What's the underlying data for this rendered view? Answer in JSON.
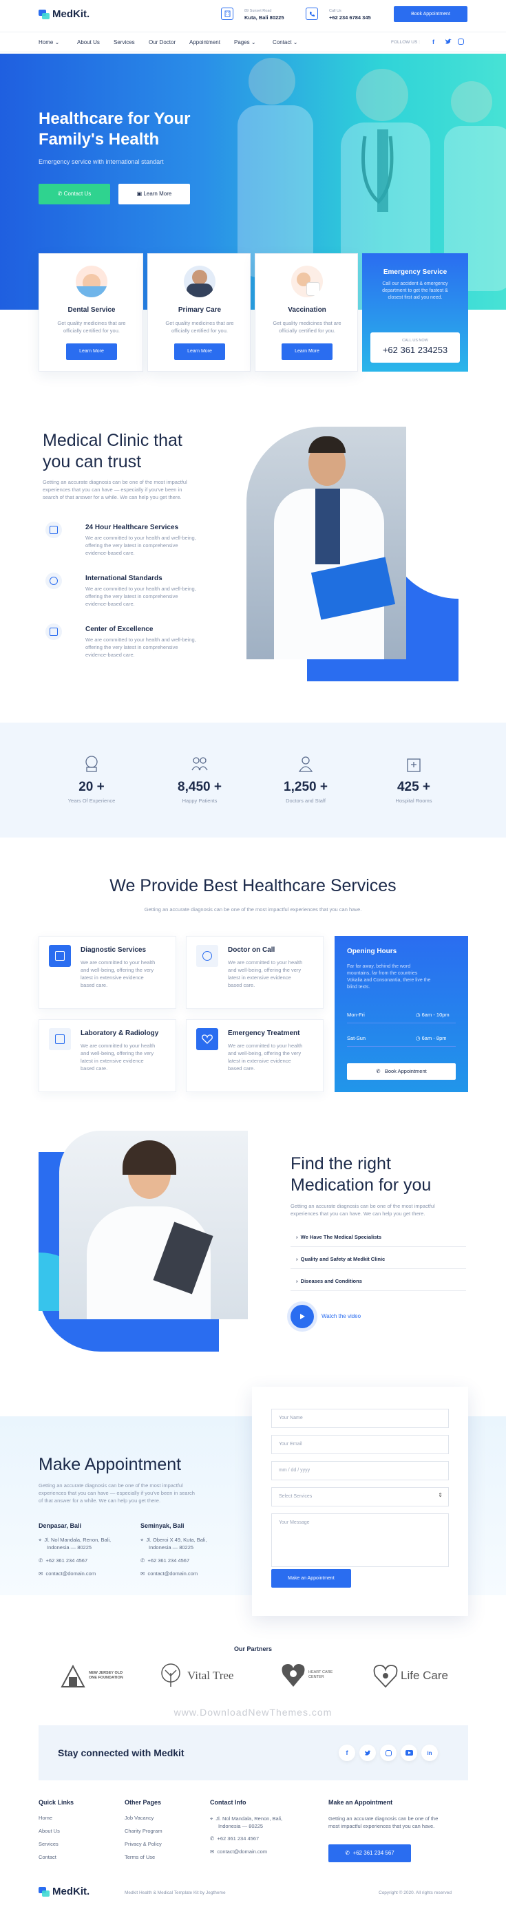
{
  "brand": {
    "name": "MedKit."
  },
  "topbar": {
    "address_small": "89 Sunset Road",
    "address": "Kuta, Bali 80225",
    "call_small": "Call Us",
    "call": "+62 234 6784 345",
    "book_label": "Book Appointment"
  },
  "nav": {
    "items": [
      "Home",
      "About Us",
      "Services",
      "Our Doctor",
      "Appointment",
      "Pages",
      "Contact"
    ],
    "follow": "FOLLOW US :"
  },
  "hero": {
    "title_line1": "Healthcare for Your",
    "title_line2": "Family's Health",
    "subtitle": "Emergency service with international standart",
    "contact_label": "Contact Us",
    "learn_label": "Learn More"
  },
  "services_top": [
    {
      "title": "Dental Service",
      "text1": "Get quality medicines that are",
      "text2": "officially certified for you.",
      "btn": "Learn More"
    },
    {
      "title": "Primary Care",
      "text1": "Get quality medicines that are",
      "text2": "officially certified for you.",
      "btn": "Learn More"
    },
    {
      "title": "Vaccination",
      "text1": "Get quality medicines that are",
      "text2": "officially certified for you.",
      "btn": "Learn More"
    }
  ],
  "emergency": {
    "title": "Emergency Service",
    "text1": "Call our accident & emergency",
    "text2": "department to get the fastest &",
    "text3": "closest first aid you need.",
    "call_small": "CALL US NOW",
    "phone": "+62 361 234253"
  },
  "clinic": {
    "title_line1": "Medical Clinic that",
    "title_line2": "you can trust",
    "intro1": "Getting an accurate diagnosis can be one of the most impactful",
    "intro2": "experiences that you can have — especially if you've been in",
    "intro3": "search of that answer for a while. We can help you get there.",
    "features": [
      {
        "title": "24 Hour Healthcare Services",
        "l1": "We are committed to your health and well-being,",
        "l2": "offering the very latest in comprehensive",
        "l3": "evidence-based care."
      },
      {
        "title": "International Standards",
        "l1": "We are committed to your health and well-being,",
        "l2": "offering the very latest in comprehensive",
        "l3": "evidence-based care."
      },
      {
        "title": "Center of Excellence",
        "l1": "We are committed to your health and well-being,",
        "l2": "offering the very latest in comprehensive",
        "l3": "evidence-based care."
      }
    ]
  },
  "stats": [
    {
      "num": "20 +",
      "label": "Years Of Experience"
    },
    {
      "num": "8,450 +",
      "label": "Happy Patients"
    },
    {
      "num": "1,250 +",
      "label": "Doctors and Staff"
    },
    {
      "num": "425 +",
      "label": "Hospital Rooms"
    }
  ],
  "provide": {
    "title": "We Provide Best Healthcare Services",
    "subtitle": "Getting an accurate diagnosis can be one of the most impactful experiences that you can have.",
    "cards": [
      {
        "title": "Diagnostic Services",
        "l1": "We are committed to your health",
        "l2": "and well-being, offering the very",
        "l3": "latest in extensive evidence",
        "l4": "based care."
      },
      {
        "title": "Doctor on Call",
        "l1": "We are committed to your health",
        "l2": "and well-being, offering the very",
        "l3": "latest in extensive evidence",
        "l4": "based care."
      },
      {
        "title": "Laboratory & Radiology",
        "l1": "We are committed to your health",
        "l2": "and well-being, offering the very",
        "l3": "latest in extensive evidence",
        "l4": "based care."
      },
      {
        "title": "Emergency Treatment",
        "l1": "We are committed to your health",
        "l2": "and well-being, offering the very",
        "l3": "latest in extensive evidence",
        "l4": "based care."
      }
    ],
    "hours": {
      "title": "Opening Hours",
      "l1": "Far far away, behind the word",
      "l2": "mountains, far from the countries",
      "l3": "Vokalia and Consonantia, there live the",
      "l4": "blind texts.",
      "d1": "Mon-Fri",
      "t1": "6am - 10pm",
      "d2": "Sat-Sun",
      "t2": "6am - 8pm",
      "btn": "Book Appointment"
    }
  },
  "medication": {
    "title_line1": "Find the right",
    "title_line2": "Medication for you",
    "intro1": "Getting an accurate diagnosis can be one of the most impactful",
    "intro2": "experiences that you can have. We can help you get there.",
    "items": [
      "We Have The Medical Specialists",
      "Quality and Safety at Medkit Clinic",
      "Diseases and Conditions"
    ],
    "video": "Watch the video"
  },
  "appointment": {
    "title": "Make Appointment",
    "intro1": "Getting an accurate diagnosis can be one of the most impactful",
    "intro2": "experiences that you can have — especially if you've been in search",
    "intro3": "of that answer for a while. We can help you get there.",
    "offices": [
      {
        "name": "Denpasar, Bali",
        "addr1": "Jl. Nol Mandala, Renon, Bali,",
        "addr2": "Indonesia — 80225",
        "phone": "+62 361 234 4567",
        "email": "contact@domain.com"
      },
      {
        "name": "Seminyak, Bali",
        "addr1": "Jl. Oberoi X 49, Kuta, Bali,",
        "addr2": "Indonesia — 80225",
        "phone": "+62 361 234 4567",
        "email": "contact@domain.com"
      }
    ],
    "form": {
      "name": "Your Name",
      "email": "Your Email",
      "date": "mm / dd / yyyy",
      "select": "Select Services",
      "message": "Your Message",
      "btn": "Make an Appointment"
    }
  },
  "partners": {
    "title": "Our Partners",
    "items": [
      "NEW JERSEY OLD ONE FOUNDATION",
      "Vital Tree",
      "HEART CARE CENTER",
      "Life Care"
    ],
    "watermark": "www.DownloadNewThemes.com"
  },
  "connected": {
    "title": "Stay connected with Medkit"
  },
  "footer": {
    "quick_title": "Quick Links",
    "quick": [
      "Home",
      "About Us",
      "Services",
      "Contact"
    ],
    "other_title": "Other Pages",
    "other": [
      "Job Vacancy",
      "Charity Program",
      "Privacy & Policy",
      "Terms of Use"
    ],
    "contact_title": "Contact Info",
    "c_addr1": "Jl. Nol Mandala, Renon, Bali,",
    "c_addr2": "Indonesia — 80225",
    "c_phone": "+62 361 234 4567",
    "c_email": "contact@domain.com",
    "appt_title": "Make an Appointment",
    "appt1": "Getting an accurate diagnosis can be one of the",
    "appt2": "most impactful experiences that you can have.",
    "appt_phone": "+62 361 234 567",
    "credit": "Medkit Health & Medical Template Kit by Jegtheme",
    "copyright": "Copyright © 2020. All rights reserved"
  },
  "colors": {
    "primary": "#2a6df0",
    "dark": "#1c2a4a",
    "teal": "#3fd9d3"
  }
}
